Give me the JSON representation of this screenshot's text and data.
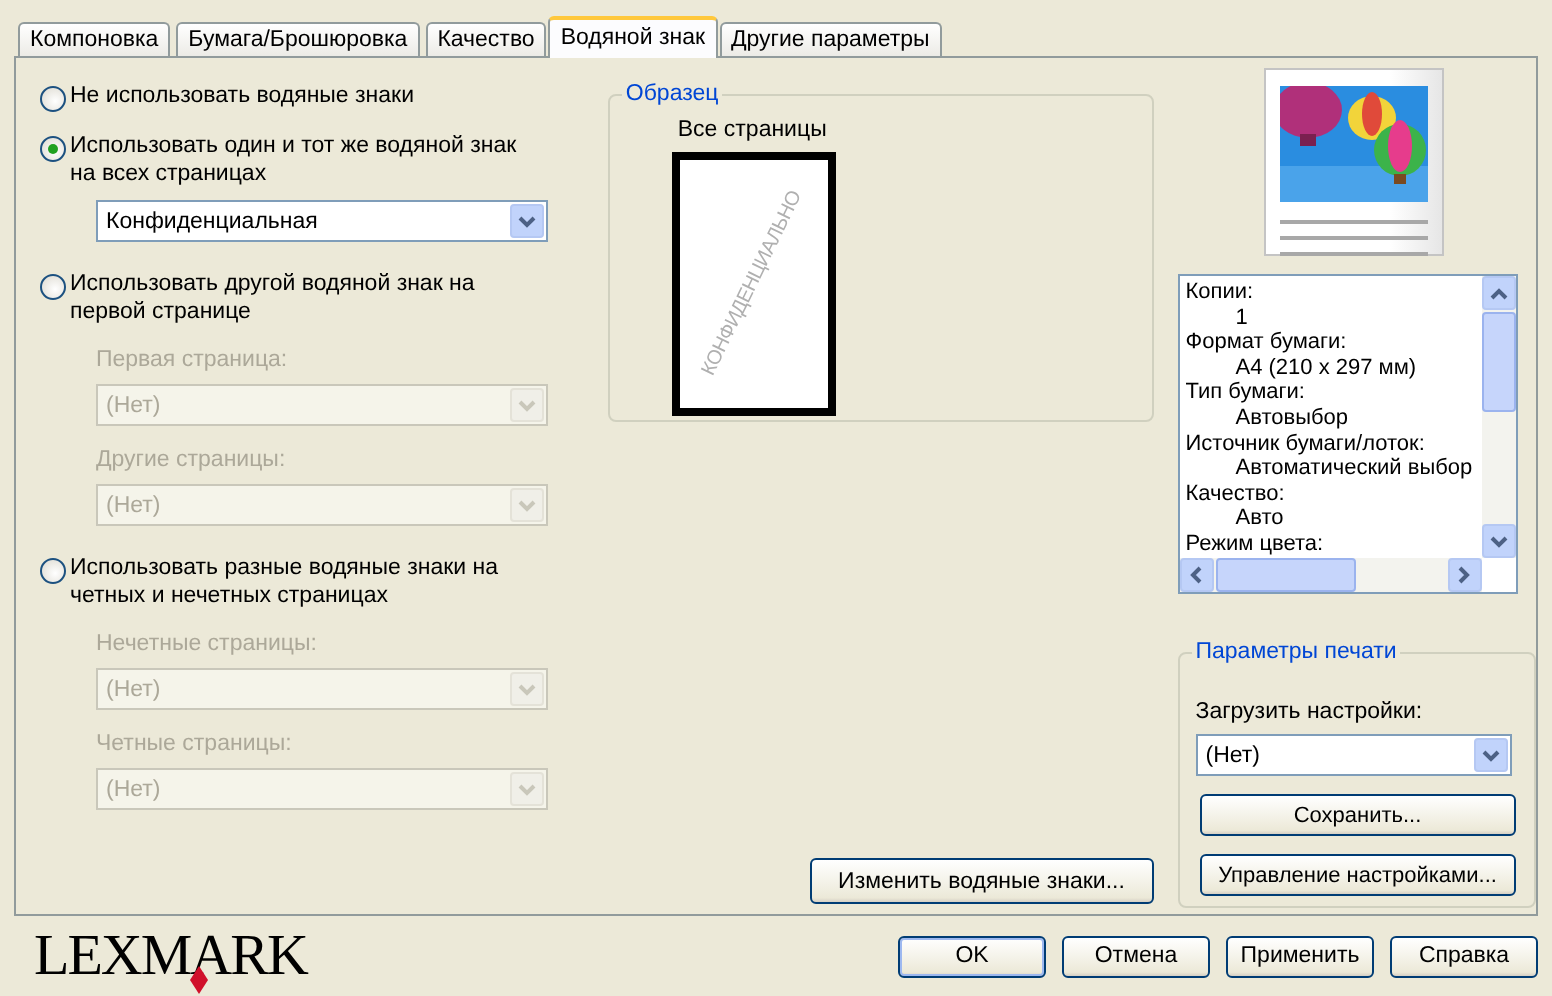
{
  "tabs": [
    {
      "label": "Компоновка",
      "selected": false
    },
    {
      "label": "Бумага/Брошюровка",
      "selected": false
    },
    {
      "label": "Качество",
      "selected": false
    },
    {
      "label": "Водяной знак",
      "selected": true
    },
    {
      "label": "Другие параметры",
      "selected": false
    }
  ],
  "watermark_options": [
    {
      "label": "Не использовать водяные знаки",
      "selected": false
    },
    {
      "label": "Использовать один и тот же водяной знак на всех страницах",
      "selected": true,
      "fields": [
        {
          "value": "Конфиденциальная",
          "disabled": false
        }
      ]
    },
    {
      "label": "Использовать другой водяной знак на первой странице",
      "selected": false,
      "fields": [
        {
          "label": "Первая страница:",
          "value": "(Нет)",
          "disabled": true
        },
        {
          "label": "Другие страницы:",
          "value": "(Нет)",
          "disabled": true
        }
      ]
    },
    {
      "label": "Использовать разные водяные знаки на четных и нечетных страницах",
      "selected": false,
      "fields": [
        {
          "label": "Нечетные страницы:",
          "value": "(Нет)",
          "disabled": true
        },
        {
          "label": "Четные страницы:",
          "value": "(Нет)",
          "disabled": true
        }
      ]
    }
  ],
  "sample": {
    "title": "Образец",
    "caption": "Все страницы",
    "watermark_text": "КОНФИДЕНЦИАЛЬНО"
  },
  "edit_button": "Изменить водяные знаки...",
  "preview": {
    "kind": "picture"
  },
  "summary": [
    {
      "label": "Копии:",
      "value": "1"
    },
    {
      "label": "Формат бумаги:",
      "value": "A4 (210 x 297 мм)"
    },
    {
      "label": "Тип бумаги:",
      "value": "Автовыбор"
    },
    {
      "label": "Источник бумаги/лоток:",
      "value": "Автоматический выбор"
    },
    {
      "label": "Качество:",
      "value": "Авто"
    },
    {
      "label": "Режим цвета:"
    }
  ],
  "print_settings": {
    "title": "Параметры печати",
    "load_label": "Загрузить настройки:",
    "load_value": "(Нет)",
    "buttons": [
      "Сохранить...",
      "Управление настройками..."
    ]
  },
  "logo": "LEXMARK",
  "dialog_buttons": [
    "OK",
    "Отмена",
    "Применить",
    "Справка"
  ]
}
